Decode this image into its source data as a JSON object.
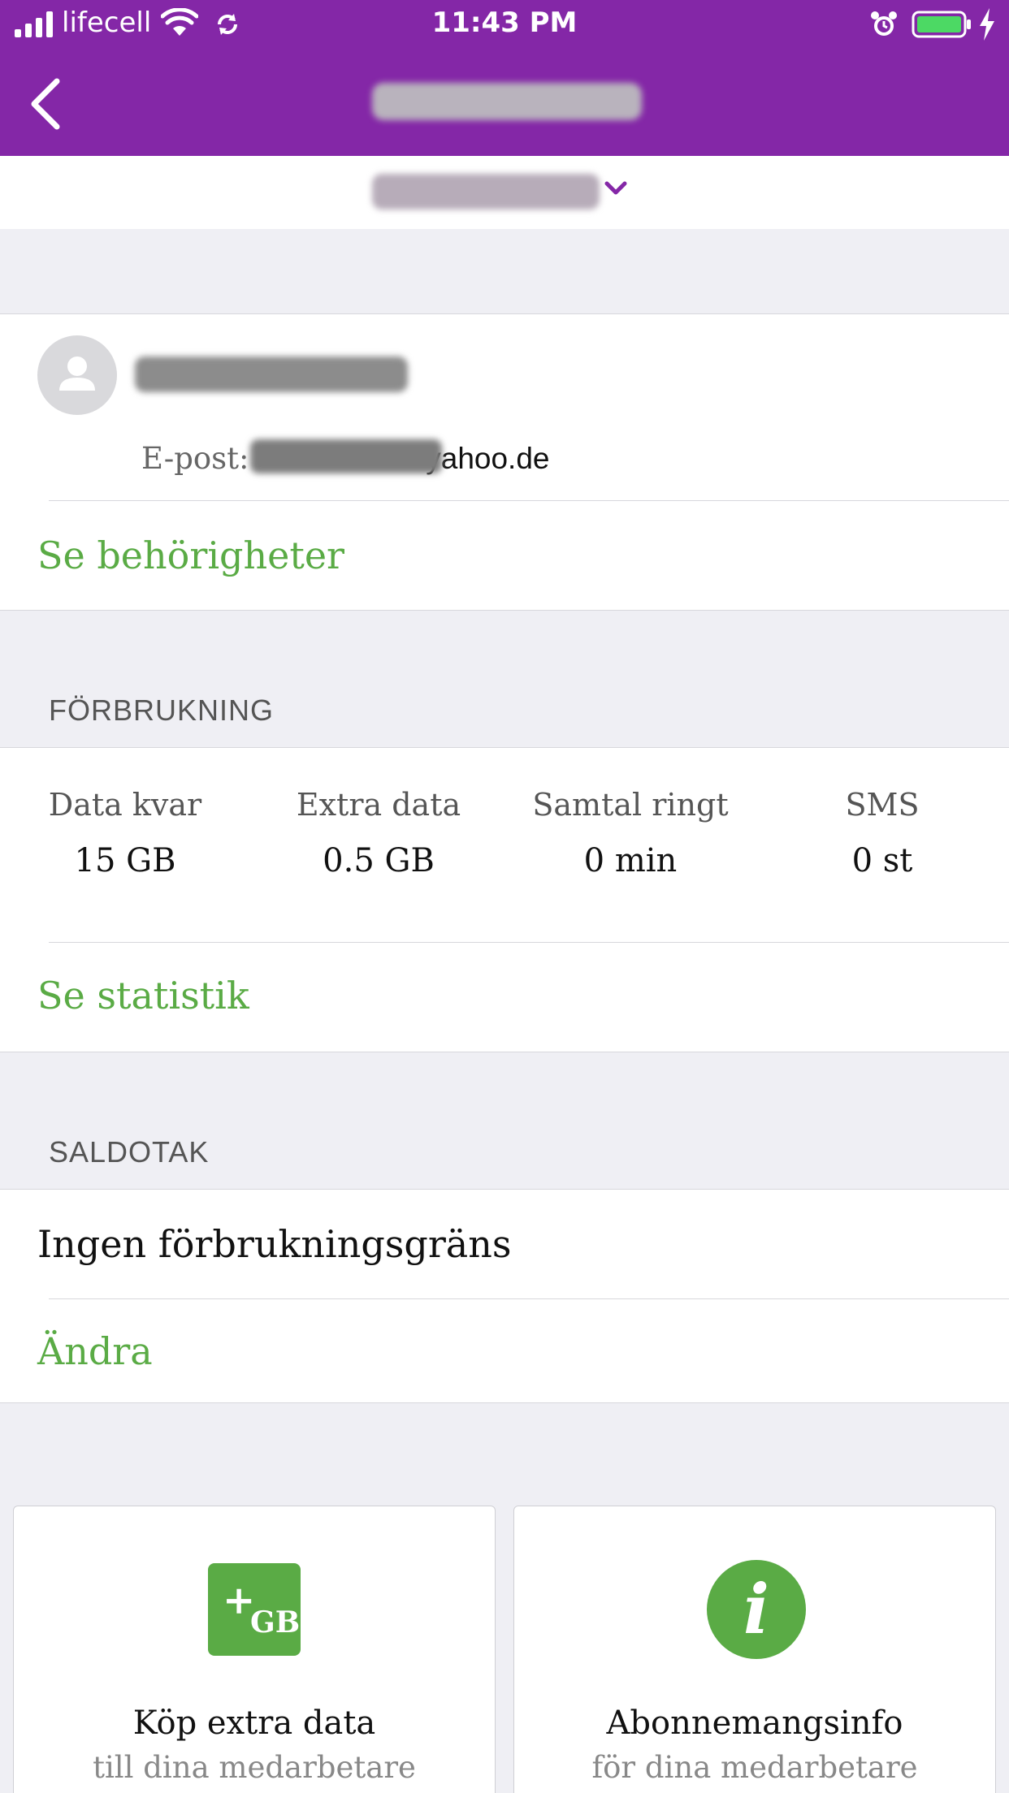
{
  "status_bar": {
    "carrier": "lifecell",
    "time": "11:43 PM"
  },
  "profile": {
    "email_label": "E-post:",
    "email_visible": "yahoo.de",
    "permissions_link": "Se behörigheter"
  },
  "usage": {
    "section_title": "FÖRBRUKNING",
    "stats": [
      {
        "label": "Data kvar",
        "value": "15 GB"
      },
      {
        "label": "Extra data",
        "value": "0.5 GB"
      },
      {
        "label": "Samtal ringt",
        "value": "0 min"
      },
      {
        "label": "SMS",
        "value": "0 st"
      }
    ],
    "statistics_link": "Se statistik"
  },
  "limit": {
    "section_title": "SALDOTAK",
    "value": "Ingen förbrukningsgräns",
    "change_link": "Ändra"
  },
  "tiles": [
    {
      "title": "Köp extra data",
      "subtitle": "till dina medarbetare",
      "icon": "plus-gb-icon",
      "icon_plus": "+",
      "icon_text": "GB"
    },
    {
      "title": "Abonnemangsinfo",
      "subtitle": "för dina medarbetare",
      "icon": "info-icon",
      "icon_text": "i"
    }
  ],
  "colors": {
    "brand_purple": "#8427a7",
    "accent_green": "#5aab45",
    "background": "#efeff4"
  }
}
